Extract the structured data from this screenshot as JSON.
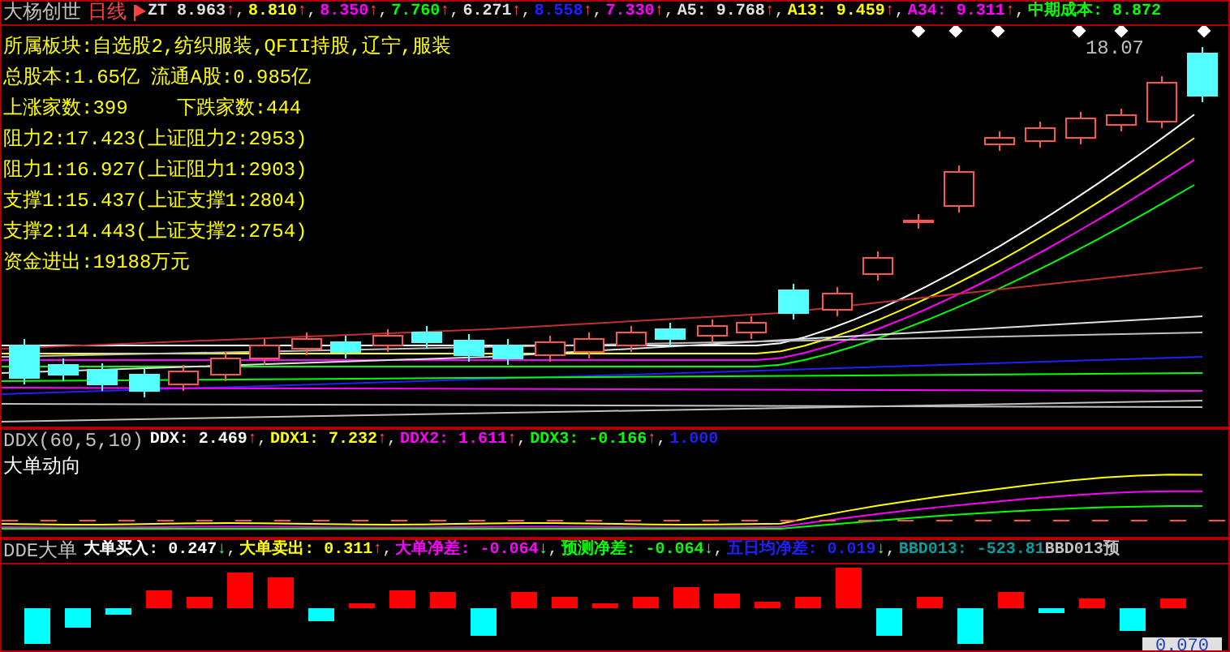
{
  "main": {
    "title": "大杨创世",
    "period": "日线",
    "indicators": [
      {
        "text": "ZT 8.963",
        "arrow": "↑",
        "sep": ","
      },
      {
        "text": "8.810",
        "arrow": "↑",
        "sep": ","
      },
      {
        "text": "8.350",
        "arrow": "↑",
        "sep": ","
      },
      {
        "text": "7.760",
        "arrow": "↑",
        "sep": ","
      },
      {
        "text": "6.271",
        "arrow": "↑",
        "sep": ","
      },
      {
        "text": "8.558",
        "arrow": "↑",
        "sep": ","
      },
      {
        "text": "7.330",
        "arrow": "↑",
        "sep": ","
      },
      {
        "text": "A5: 9.768",
        "arrow": "↑",
        "sep": ","
      },
      {
        "text": "A13: 9.459",
        "arrow": "↑",
        "sep": ","
      },
      {
        "text": "A34: 9.311",
        "arrow": "↑",
        "sep": ","
      },
      {
        "text": "中期成本: 8.872"
      }
    ],
    "info_lines": [
      [
        "所属板块:自选股2,纺织服装,QFII持股,辽宁,服装"
      ],
      [
        "总股本:1.65亿 流通A股:0.985亿"
      ],
      [
        "上涨家数:399",
        "下跌家数:444"
      ],
      [
        "阻力2:17.423(上证阻力2:2953)"
      ],
      [
        "阻力1:16.927(上证阻力1:2903)"
      ],
      [
        "支撑1:15.437(上证支撑1:2804)"
      ],
      [
        "支撑2:14.443(上证支撑2:2754)"
      ],
      [
        "资金进出:19188万元"
      ]
    ],
    "high_label": "18.07"
  },
  "ddx": {
    "title": "DDX(60,5,10)",
    "indicators": [
      {
        "text": "DDX: 2.469",
        "arrow": "↑",
        "sep": ","
      },
      {
        "text": "DDX1: 7.232",
        "arrow": "↑",
        "sep": ","
      },
      {
        "text": "DDX2: 1.611",
        "arrow": "↑",
        "sep": ","
      },
      {
        "text": "DDX3: -0.166",
        "arrow": "↑",
        "sep": ","
      },
      {
        "text": "1.000"
      }
    ],
    "subtitle": "大单动向"
  },
  "dde": {
    "title": "DDE大单",
    "indicators": [
      {
        "text": "大单买入: 0.247",
        "arrow": "↓",
        "sep": ","
      },
      {
        "text": "大单卖出: 0.311",
        "arrow": "↑",
        "sep": ","
      },
      {
        "text": "大单净差: -0.064",
        "arrow": "↓",
        "sep": ","
      },
      {
        "text": "预测净差: -0.064",
        "arrow": "↓",
        "sep": ","
      },
      {
        "text": "五日均净差: 0.019",
        "arrow": "↓",
        "sep": ","
      },
      {
        "text": "BBD013: -523.81"
      },
      {
        "text": "BBD013预"
      }
    ],
    "corner_value": "0.070"
  }
}
